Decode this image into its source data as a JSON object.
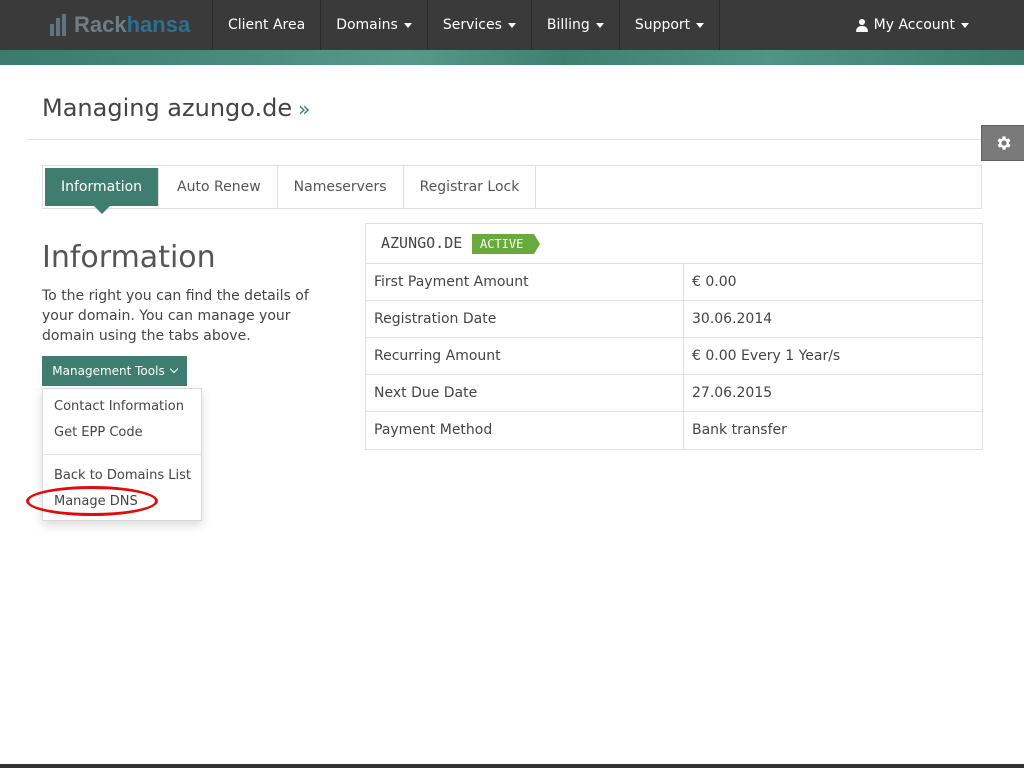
{
  "brand": {
    "part1": "Rack",
    "part2": "hansa"
  },
  "nav": {
    "items": [
      {
        "label": "Client Area",
        "dropdown": false
      },
      {
        "label": "Domains",
        "dropdown": true
      },
      {
        "label": "Services",
        "dropdown": true
      },
      {
        "label": "Billing",
        "dropdown": true
      },
      {
        "label": "Support",
        "dropdown": true
      }
    ],
    "account_label": "My Account"
  },
  "page": {
    "title": "Managing azungo.de",
    "title_suffix": "»"
  },
  "tabs": [
    {
      "label": "Information",
      "active": true
    },
    {
      "label": "Auto Renew",
      "active": false
    },
    {
      "label": "Nameservers",
      "active": false
    },
    {
      "label": "Registrar Lock",
      "active": false
    }
  ],
  "info": {
    "heading": "Information",
    "text": "To the right you can find the details of your domain. You can manage your domain using the tabs above."
  },
  "management": {
    "button_label": "Management Tools",
    "menu": [
      {
        "label": "Contact Information"
      },
      {
        "label": "Get EPP Code"
      },
      {
        "label": "Back to Domains List"
      },
      {
        "label": "Manage DNS",
        "highlighted": true
      }
    ]
  },
  "domain": {
    "name": "AZUNGO.DE",
    "status": "ACTIVE",
    "rows": [
      {
        "label": "First Payment Amount",
        "value": "€ 0.00"
      },
      {
        "label": "Registration Date",
        "value": "30.06.2014"
      },
      {
        "label": "Recurring Amount",
        "value": "€ 0.00 Every 1 Year/s"
      },
      {
        "label": "Next Due Date",
        "value": "27.06.2015"
      },
      {
        "label": "Payment Method",
        "value": "Bank transfer"
      }
    ]
  },
  "colors": {
    "primary": "#3e7d70",
    "topbar": "#3a3a3a",
    "status_active": "#6aaa3c",
    "highlight_ring": "#e20b0b"
  }
}
